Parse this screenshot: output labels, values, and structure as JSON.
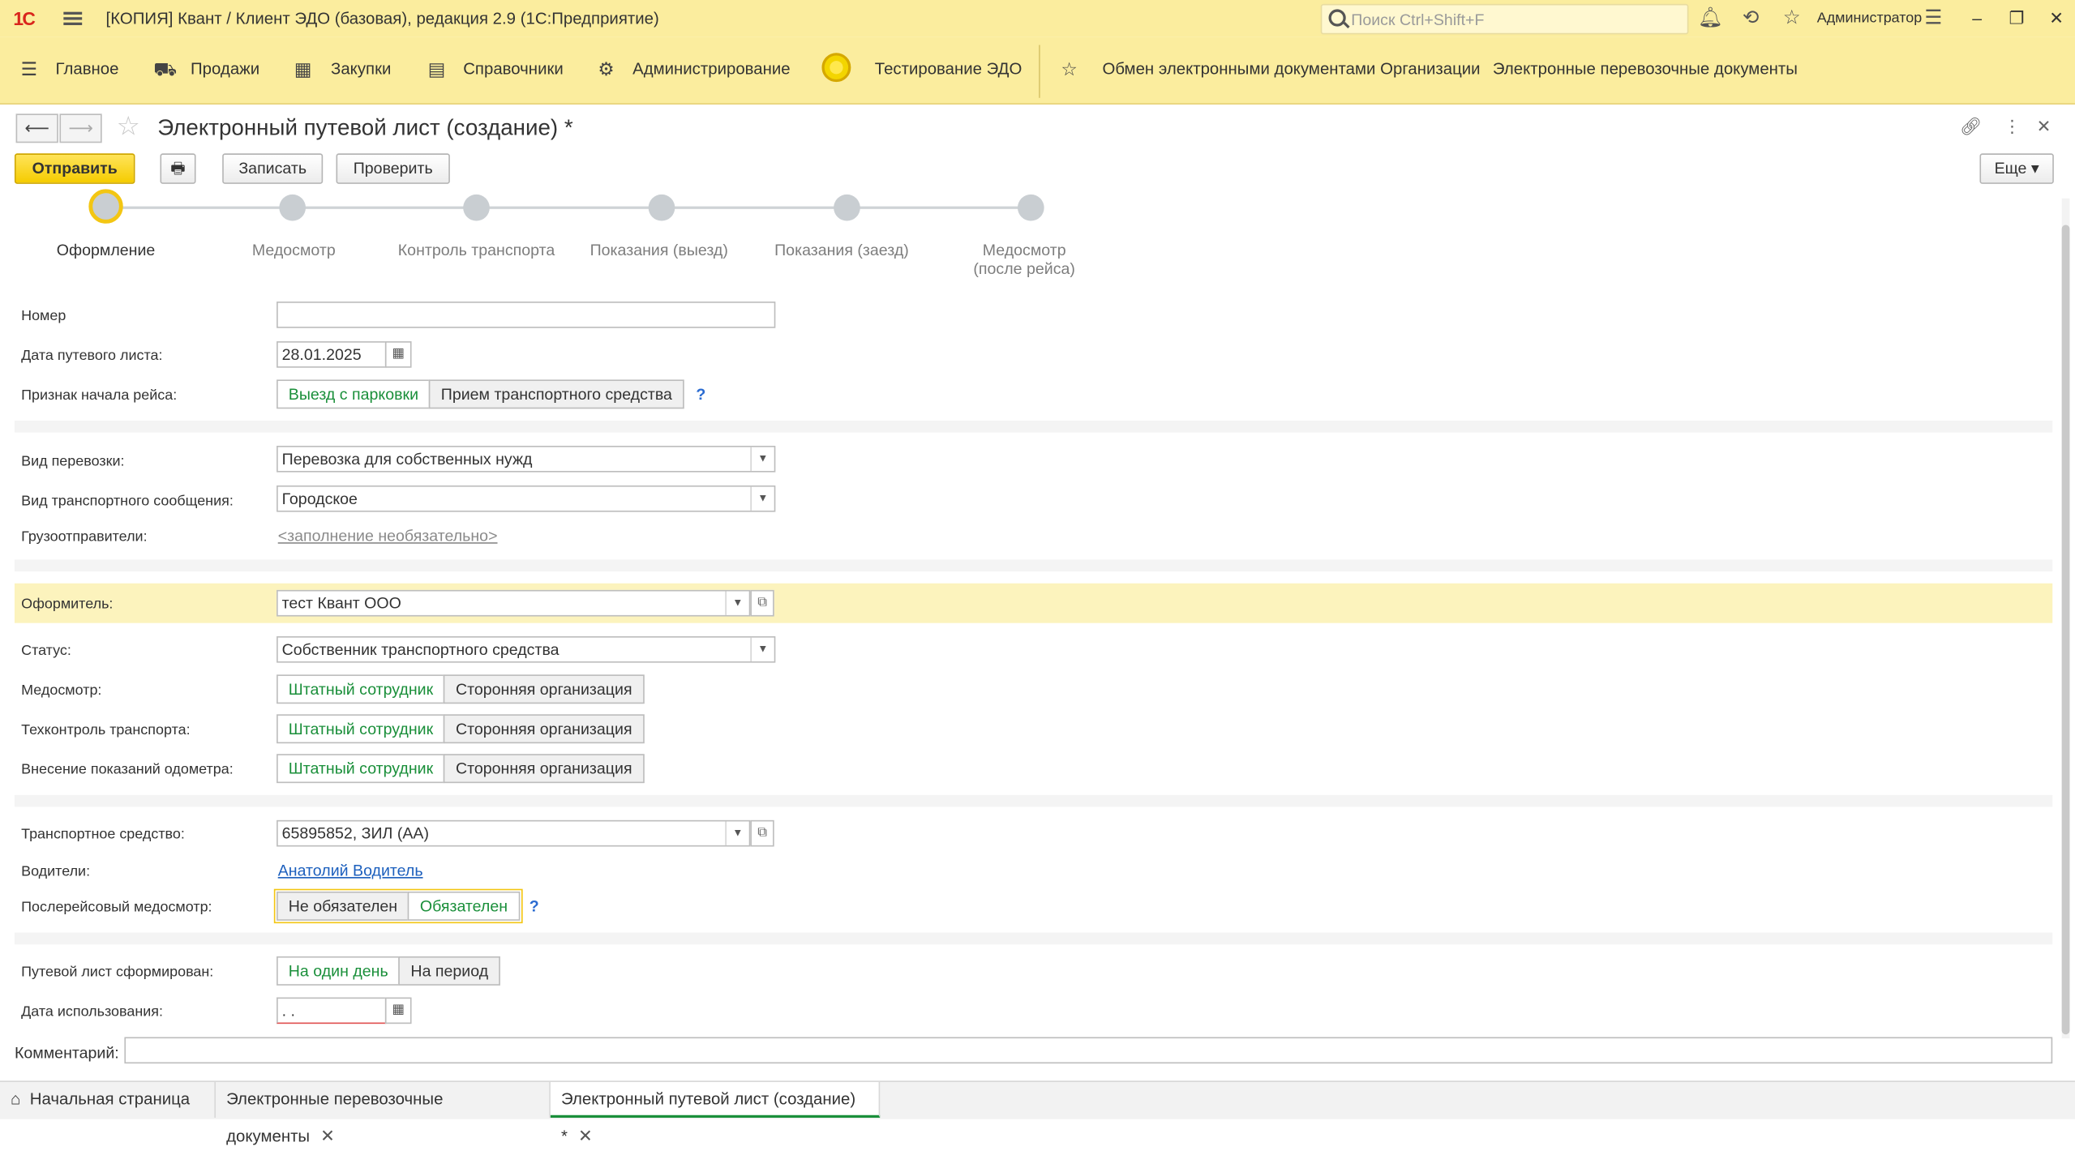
{
  "titlebar": {
    "logo": "1С",
    "title": "[КОПИЯ] Квант / Клиент ЭДО (базовая), редакция 2.9  (1С:Предприятие)",
    "search_placeholder": "Поиск Ctrl+Shift+F",
    "user": "Администратор"
  },
  "sections": {
    "items": [
      "Главное",
      "Продажи",
      "Закупки",
      "Справочники",
      "Администрирование",
      "Тестирование ЭДО"
    ],
    "favorites": [
      "Обмен электронными документами",
      "Организации",
      "Электронные перевозочные документы"
    ]
  },
  "form": {
    "title": "Электронный путевой лист (создание) *",
    "buttons": {
      "send": "Отправить",
      "save": "Записать",
      "check": "Проверить",
      "more": "Еще"
    }
  },
  "steps": [
    "Оформление",
    "Медосмотр",
    "Контроль транспорта",
    "Показания (выезд)",
    "Показания (заезд)",
    "Медосмотр\n(после рейса)"
  ],
  "fields": {
    "number": {
      "label": "Номер",
      "value": ""
    },
    "date": {
      "label": "Дата путевого листа:",
      "value": "28.01.2025"
    },
    "trip_start": {
      "label": "Признак начала рейса:",
      "options": [
        "Выезд с парковки",
        "Прием транспортного средства"
      ],
      "selected": 0
    },
    "transport_type": {
      "label": "Вид перевозки:",
      "value": "Перевозка для собственных нужд"
    },
    "connection_type": {
      "label": "Вид транспортного сообщения:",
      "value": "Городское"
    },
    "shippers": {
      "label": "Грузоотправители:",
      "value": "<заполнение необязательно>"
    },
    "issuer": {
      "label": "Оформитель:",
      "value": "тест Квант ООО"
    },
    "status": {
      "label": "Статус:",
      "value": "Собственник транспортного средства"
    },
    "medical": {
      "label": "Медосмотр:",
      "options": [
        "Штатный сотрудник",
        "Сторонняя организация"
      ],
      "selected": 0
    },
    "techcontrol": {
      "label": "Техконтроль транспорта:",
      "options": [
        "Штатный сотрудник",
        "Сторонняя организация"
      ],
      "selected": 0
    },
    "odometer": {
      "label": "Внесение показаний одометра:",
      "options": [
        "Штатный сотрудник",
        "Сторонняя организация"
      ],
      "selected": 0
    },
    "vehicle": {
      "label": "Транспортное средство:",
      "value": "65895852, ЗИЛ  (АА)"
    },
    "drivers": {
      "label": "Водители:",
      "value": "Анатолий Водитель"
    },
    "post_medical": {
      "label": "Послерейсовый медосмотр:",
      "options": [
        "Не обязателен",
        "Обязателен"
      ],
      "selected": 1
    },
    "formed": {
      "label": "Путевой лист сформирован:",
      "options": [
        "На один день",
        "На период"
      ],
      "selected": 0
    },
    "usage_date": {
      "label": "Дата использования:",
      "value": " .  ."
    },
    "comment": {
      "label": "Комментарий:",
      "value": ""
    }
  },
  "tabs": [
    "Начальная страница",
    "Электронные перевозочные документы",
    "Электронный путевой лист (создание) *"
  ],
  "colors": {
    "accent_yellow": "#fbed9e",
    "selected_green": "#1a8f3a",
    "link_blue": "#1c5fbd"
  }
}
